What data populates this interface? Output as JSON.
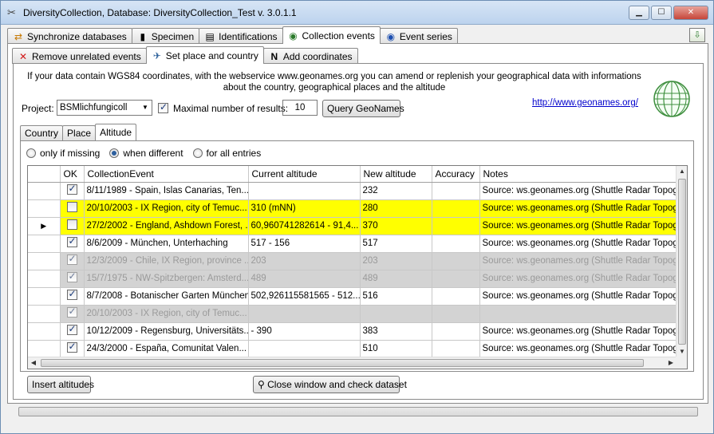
{
  "window": {
    "title": "DiversityCollection,  Database: DiversityCollection_Test    v. 3.0.1.1",
    "buttons": [
      "minimize",
      "maximize",
      "close"
    ]
  },
  "main_tabs": [
    {
      "label": "Synchronize databases",
      "icon": "sync-icon",
      "active": false
    },
    {
      "label": "Specimen",
      "icon": "barcode-icon",
      "active": false
    },
    {
      "label": "Identifications",
      "icon": "document-icon",
      "active": false
    },
    {
      "label": "Collection events",
      "icon": "globe-icon",
      "active": true
    },
    {
      "label": "Event series",
      "icon": "globe-series-icon",
      "active": false
    }
  ],
  "sub_tabs": [
    {
      "label": "Remove unrelated events",
      "icon": "x-mark-icon",
      "active": false
    },
    {
      "label": "Set place and country",
      "icon": "place-icon",
      "active": true
    },
    {
      "label": "Add coordinates",
      "icon": "north-arrow-icon",
      "active": false
    }
  ],
  "info_text": "If your data contain WGS84 coordinates, with the webservice www.geonames.org you can amend or replenish your geographical data with informations about the country,  geographical places and the altitude",
  "geonames_link": "http://www.geonames.org/",
  "project": {
    "label": "Project:",
    "value": "BSMlichfungicoll"
  },
  "max_results": {
    "label": "Maximal number of results:",
    "checked": true,
    "value": "10"
  },
  "query_button": "Query GeoNames",
  "detail_tabs": [
    {
      "label": "Country",
      "active": false
    },
    {
      "label": "Place",
      "active": false
    },
    {
      "label": "Altitude",
      "active": true
    }
  ],
  "radio_options": [
    {
      "label": "only if missing",
      "selected": false
    },
    {
      "label": "when different",
      "selected": true
    },
    {
      "label": "for all entries",
      "selected": false
    }
  ],
  "grid": {
    "columns": [
      "OK",
      "CollectionEvent",
      "Current altitude",
      "New altitude",
      "Accuracy",
      "Notes"
    ],
    "rows": [
      {
        "ok": true,
        "event": "8/11/1989 - Spain, Islas Canarias, Ten...",
        "current": "",
        "new": "232",
        "accuracy": "",
        "notes": "Source: ws.geonames.org (Shuttle Radar Topograp",
        "style": "normal",
        "current_row": false
      },
      {
        "ok": false,
        "event": "20/10/2003 - IX Region, city of Temuc...",
        "current": "310 (mNN)",
        "new": "280",
        "accuracy": "",
        "notes": "Source: ws.geonames.org (Shuttle Radar Topograp",
        "style": "yellow",
        "current_row": false
      },
      {
        "ok": false,
        "event": "27/2/2002 - England, Ashdown Forest, ...",
        "current": "60,960741282614 - 91,4...",
        "new": "370",
        "accuracy": "",
        "notes": "Source: ws.geonames.org (Shuttle Radar Topograp",
        "style": "yellow",
        "current_row": true
      },
      {
        "ok": true,
        "event": "8/6/2009 - München, Unterhaching",
        "current": "517 - 156",
        "new": "517",
        "accuracy": "",
        "notes": "Source: ws.geonames.org (Shuttle Radar Topograp",
        "style": "normal",
        "current_row": false
      },
      {
        "ok": true,
        "event": "12/3/2009 - Chile, IX Region, province ...",
        "current": "203",
        "new": "203",
        "accuracy": "",
        "notes": "Source: ws.geonames.org (Shuttle Radar Topograp",
        "style": "gray",
        "current_row": false
      },
      {
        "ok": true,
        "event": "15/7/1975 - NW-Spitzbergen: Amsterd...",
        "current": "489",
        "new": "489",
        "accuracy": "",
        "notes": "Source: ws.geonames.org (Shuttle Radar Topograp",
        "style": "gray",
        "current_row": false
      },
      {
        "ok": true,
        "event": "8/7/2008 - Botanischer Garten München",
        "current": "502,926115581565 - 512...",
        "new": "516",
        "accuracy": "",
        "notes": "Source: ws.geonames.org (Shuttle Radar Topograp",
        "style": "normal",
        "current_row": false
      },
      {
        "ok": true,
        "event": "20/10/2003 - IX Region, city of Temuc...",
        "current": "",
        "new": "",
        "accuracy": "",
        "notes": "",
        "style": "gray",
        "current_row": false
      },
      {
        "ok": true,
        "event": "10/12/2009 - Regensburg, Universitäts...",
        "current": " - 390",
        "new": "383",
        "accuracy": "",
        "notes": "Source: ws.geonames.org (Shuttle Radar Topograp",
        "style": "normal",
        "current_row": false
      },
      {
        "ok": true,
        "event": "24/3/2000 - España, Comunitat Valen...",
        "current": "",
        "new": "510",
        "accuracy": "",
        "notes": "Source: ws.geonames.org (Shuttle Radar Topograp",
        "style": "normal",
        "current_row": false
      }
    ]
  },
  "insert_button": "Insert altitudes",
  "close_button": "Close window and check dataset",
  "progress": 0
}
